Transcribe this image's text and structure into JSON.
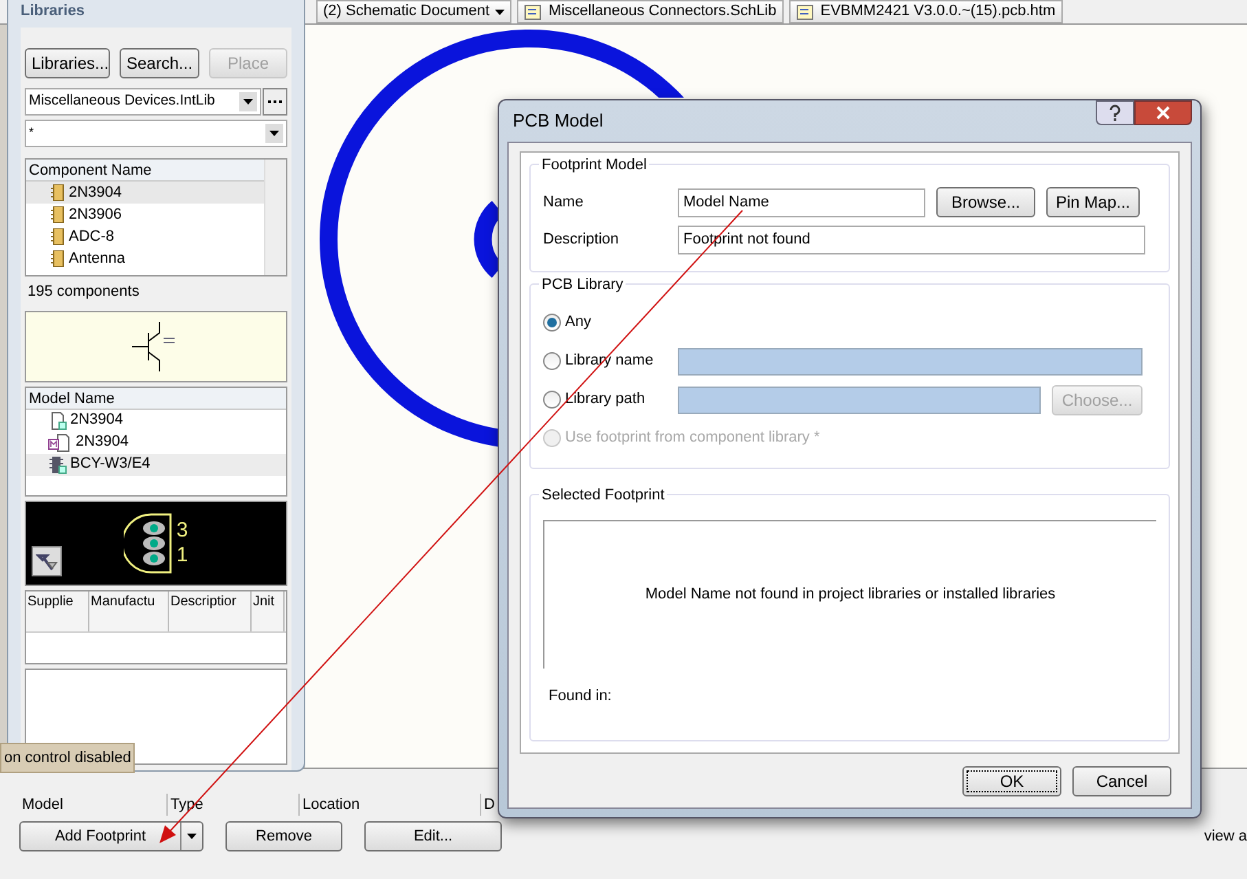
{
  "doc_tabs": [
    {
      "label": "(2) Schematic Document",
      "dropdown": true
    },
    {
      "label": "Miscellaneous Connectors.SchLib",
      "dropdown": false
    },
    {
      "label": "EVBMM2421 V3.0.0.~(15).pcb.htm",
      "dropdown": false
    }
  ],
  "libraries_panel": {
    "title": "Libraries",
    "buttons": [
      {
        "label": "Libraries...",
        "disabled": false
      },
      {
        "label": "Search...",
        "disabled": false
      },
      {
        "label": "Place",
        "disabled": true
      }
    ],
    "library": "Miscellaneous Devices.IntLib",
    "filter": "*",
    "component_column": "Component Name",
    "components": [
      {
        "name": "2N3904",
        "selected": true
      },
      {
        "name": "2N3906",
        "selected": false
      },
      {
        "name": "ADC-8",
        "selected": false
      },
      {
        "name": "Antenna",
        "selected": false
      }
    ],
    "count": "195 components",
    "model_column": "Model Name",
    "models": [
      {
        "name": "2N3904",
        "kind": "simulation",
        "selected": false
      },
      {
        "name": "2N3904",
        "kind": "model",
        "selected": false
      },
      {
        "name": "BCY-W3/E4",
        "kind": "footprint",
        "selected": true
      }
    ],
    "pin_labels": [
      "3",
      "1"
    ],
    "supplier_columns": [
      "Supplie",
      "Manufactu",
      "Descriptior",
      "Jnit"
    ]
  },
  "tooltip": "on control disabled",
  "models_panel": {
    "columns": [
      "Model",
      "Type",
      "Location",
      "D"
    ],
    "buttons": [
      {
        "label": "Add Footprint",
        "dropdown": true
      },
      {
        "label": "Remove",
        "dropdown": false
      },
      {
        "label": "Edit...",
        "dropdown": false
      }
    ],
    "side_text": "view a"
  },
  "dialog": {
    "title": "PCB Model",
    "footprint_group": "Footprint Model",
    "name_label": "Name",
    "name_value": "Model Name",
    "browse": "Browse...",
    "pin_map": "Pin Map...",
    "description_label": "Description",
    "description_value": "Footprint not found",
    "library_group": "PCB Library",
    "options": [
      {
        "label": "Any",
        "kind": "plain",
        "selected": true,
        "disabled": false
      },
      {
        "label": "Library name",
        "kind": "field",
        "selected": false,
        "disabled": false
      },
      {
        "label": "Library path",
        "kind": "field_button",
        "button": "Choose...",
        "selected": false,
        "disabled": false
      },
      {
        "label": "Use footprint from component library *",
        "kind": "plain",
        "selected": false,
        "disabled": true
      }
    ],
    "selected_group": "Selected Footprint",
    "message": "Model Name not found in project libraries or installed libraries",
    "found_in": "Found in:",
    "ok": "OK",
    "cancel": "Cancel"
  }
}
